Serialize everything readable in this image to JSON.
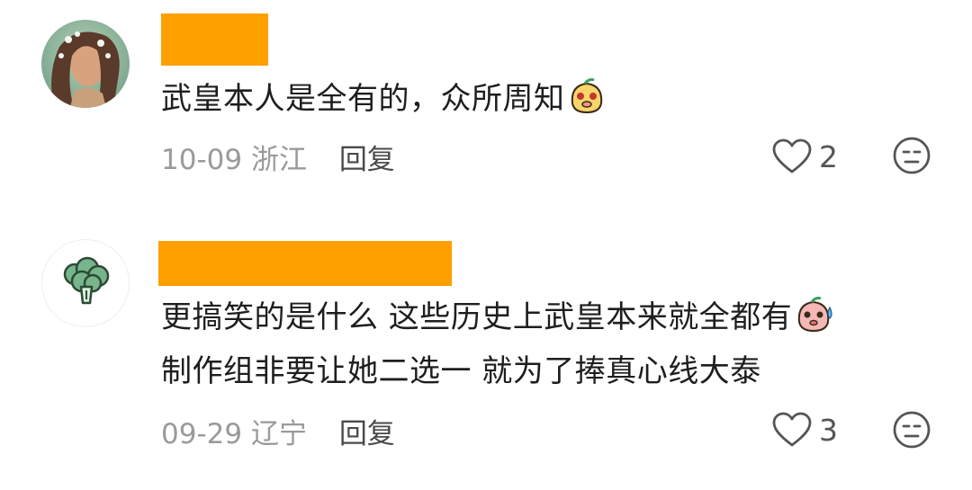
{
  "comments": [
    {
      "text": "武皇本人是全有的，众所周知",
      "date": "10-09",
      "location": "浙江",
      "reply_label": "回复",
      "like_count": "2",
      "avatar_icon": "portrait-avatar",
      "emoji_icon": "blushing-face-sticker"
    },
    {
      "text_line1": "更搞笑的是什么 这些历史上武皇本来就全都有",
      "text_line2": "制作组非要让她二选一 就为了捧真心线大泰",
      "date": "09-29",
      "location": "辽宁",
      "reply_label": "回复",
      "like_count": "3",
      "avatar_icon": "broccoli-avatar",
      "emoji_icon": "sweating-face-sticker"
    }
  ],
  "colors": {
    "redaction": "#FF9F00",
    "meta_text": "#9a9a9a",
    "body_text": "#1e1e1e",
    "icon_stroke": "#555555"
  },
  "icons": {
    "like": "heart-outline-icon",
    "dislike": "meh-face-icon"
  }
}
